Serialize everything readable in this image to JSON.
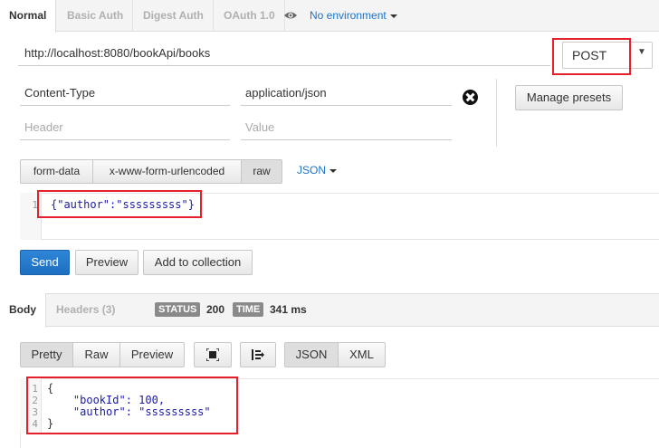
{
  "auth_tabs": [
    "Normal",
    "Basic Auth",
    "Digest Auth",
    "OAuth 1.0"
  ],
  "environment": "No environment",
  "request": {
    "url": "http://localhost:8080/bookApi/books",
    "method": "POST"
  },
  "headers": {
    "rows": [
      {
        "key": "Content-Type",
        "value": "application/json"
      }
    ],
    "key_placeholder": "Header",
    "value_placeholder": "Value",
    "manage_presets": "Manage presets"
  },
  "body_types": [
    "form-data",
    "x-www-form-urlencoded",
    "raw"
  ],
  "raw_format": "JSON",
  "request_body": {
    "line_numbers": [
      "1"
    ],
    "lines": [
      "{\"author\":\"sssssssss\"}"
    ]
  },
  "actions": {
    "send": "Send",
    "preview": "Preview",
    "add_to_collection": "Add to collection"
  },
  "response": {
    "tabs": [
      "Body",
      "Headers (3)"
    ],
    "status_label": "STATUS",
    "status": "200",
    "time_label": "TIME",
    "time": "341 ms",
    "view_buttons": [
      "Pretty",
      "Raw",
      "Preview"
    ],
    "format_buttons": [
      "JSON",
      "XML"
    ],
    "line_numbers": [
      "1",
      "2",
      "3",
      "4"
    ],
    "lines": [
      "{",
      "    \"bookId\": 100,",
      "    \"author\": \"sssssssss\"",
      "}"
    ]
  },
  "colors": {
    "accent": "#1a73c8",
    "send": "#1d6fc0",
    "highlight": "#e4202a"
  }
}
